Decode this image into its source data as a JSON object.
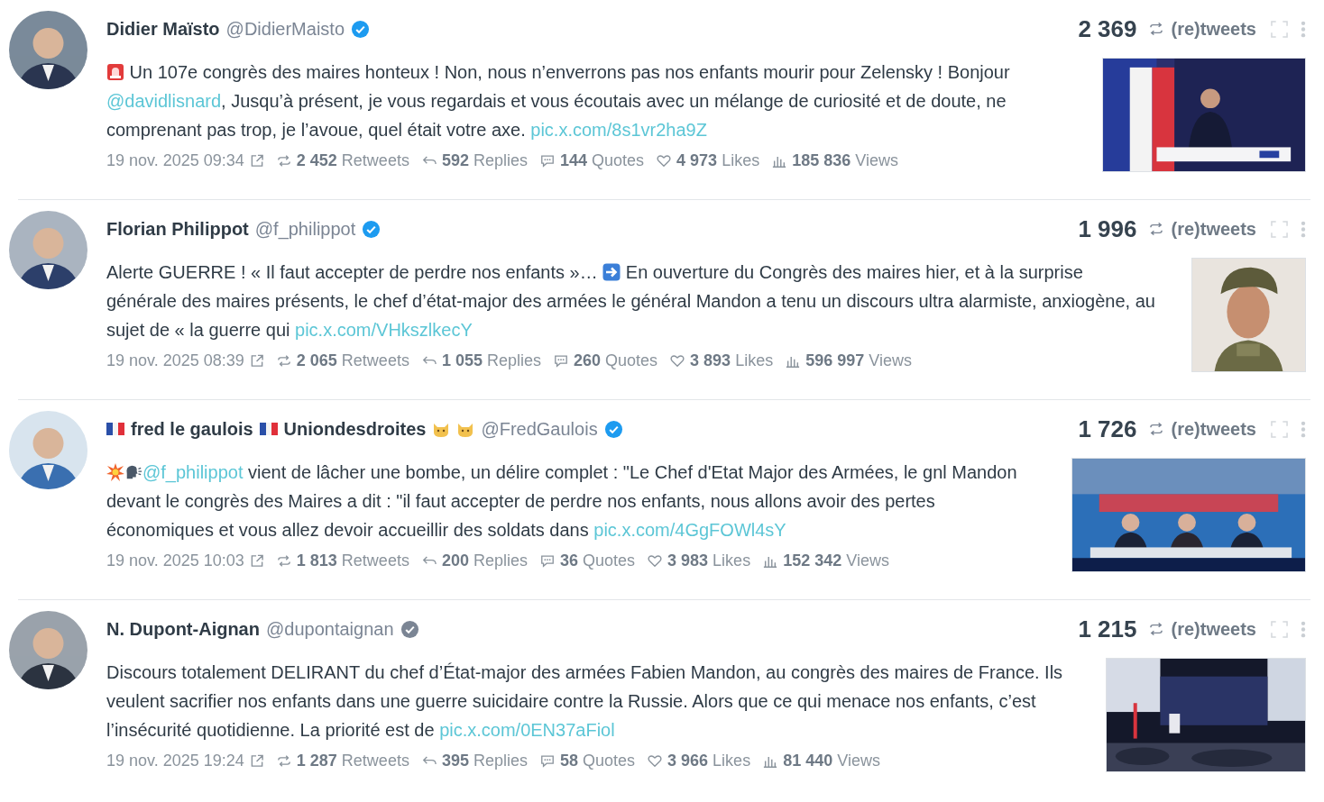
{
  "tweets": [
    {
      "avatar": {
        "kind": "picture"
      },
      "name": [
        {
          "kind": "text",
          "text": "Didier Maïsto"
        }
      ],
      "handle": "@DidierMaisto",
      "badge": {
        "color": "#1d9bf0"
      },
      "count": "2 369",
      "count_label": "(re)tweets",
      "body": [
        {
          "kind": "siren"
        },
        {
          "kind": "text",
          "text": " Un 107e congrès des maires honteux ! Non, nous n’enverrons pas nos enfants mourir pour Zelensky ! Bonjour "
        },
        {
          "kind": "link",
          "text": "@davidlisnard"
        },
        {
          "kind": "text",
          "text": ", Jusqu’à présent, je vous regardais et vous écoutais avec un mélange de curiosité et de doute, ne comprenant pas trop, je l’avoue, quel était votre axe. "
        },
        {
          "kind": "link",
          "text": "pic.x.com/8s1vr2ha9Z"
        }
      ],
      "date": "19 nov. 2025 09:34",
      "stats": [
        {
          "kind": "retweets",
          "text": "**2 452** Retweets"
        },
        {
          "kind": "replies",
          "text": "**592** Replies"
        },
        {
          "kind": "quotes",
          "text": "**144** Quotes"
        },
        {
          "kind": "likes",
          "text": "**4 973** Likes"
        },
        {
          "kind": "views",
          "text": "**185 836** Views"
        }
      ],
      "media": {
        "kind": "picture"
      }
    },
    {
      "avatar": {
        "kind": "picture"
      },
      "name": [
        {
          "kind": "text",
          "text": "Florian Philippot"
        }
      ],
      "handle": "@f_philippot",
      "badge": {
        "color": "#1d9bf0"
      },
      "count": "1 996",
      "count_label": "(re)tweets",
      "body": [
        {
          "kind": "text",
          "text": "Alerte GUERRE ! « Il faut accepter de perdre nos enfants »… "
        },
        {
          "kind": "arrow"
        },
        {
          "kind": "text",
          "text": " En ouverture du Congrès des maires hier, et à la surprise générale des maires présents, le chef d’état-major des armées le général Mandon a tenu un discours ultra alarmiste, anxiogène, au sujet de « la guerre qui "
        },
        {
          "kind": "link",
          "text": "pic.x.com/VHkszlkecY"
        }
      ],
      "date": "19 nov. 2025 08:39",
      "stats": [
        {
          "kind": "retweets",
          "text": "**2 065** Retweets"
        },
        {
          "kind": "replies",
          "text": "**1 055** Replies"
        },
        {
          "kind": "quotes",
          "text": "**260** Quotes"
        },
        {
          "kind": "likes",
          "text": "**3 893** Likes"
        },
        {
          "kind": "views",
          "text": "**596 997** Views"
        }
      ],
      "media": {
        "kind": "picture"
      }
    },
    {
      "avatar": {
        "kind": "picture"
      },
      "name": [
        {
          "kind": "flag"
        },
        {
          "kind": "text",
          "text": "fred le gaulois"
        },
        {
          "kind": "flag"
        },
        {
          "kind": "text",
          "text": "Uniondesdroites"
        },
        {
          "kind": "cat"
        },
        {
          "kind": "cat"
        }
      ],
      "handle": "@FredGaulois",
      "badge": {
        "color": "#1d9bf0"
      },
      "count": "1 726",
      "count_label": "(re)tweets",
      "body": [
        {
          "kind": "explosion"
        },
        {
          "kind": "speaking"
        },
        {
          "kind": "link",
          "text": "@f_philippot"
        },
        {
          "kind": "text",
          "text": " vient de lâcher une bombe, un délire complet : \"Le Chef d'Etat Major des Armées, le gnl Mandon devant le congrès des Maires a dit : \"il faut accepter de perdre nos enfants, nous allons avoir des pertes économiques et vous allez devoir accueillir des soldats dans "
        },
        {
          "kind": "link",
          "text": "pic.x.com/4GgFOWl4sY"
        }
      ],
      "date": "19 nov. 2025 10:03",
      "stats": [
        {
          "kind": "retweets",
          "text": "**1 813** Retweets"
        },
        {
          "kind": "replies",
          "text": "**200** Replies"
        },
        {
          "kind": "quotes",
          "text": "**36** Quotes"
        },
        {
          "kind": "likes",
          "text": "**3 983** Likes"
        },
        {
          "kind": "views",
          "text": "**152 342** Views"
        }
      ],
      "media": {
        "kind": "picture"
      }
    },
    {
      "avatar": {
        "kind": "picture"
      },
      "name": [
        {
          "kind": "text",
          "text": "N. Dupont-Aignan"
        }
      ],
      "handle": "@dupontaignan",
      "badge": {
        "color": "#7b8594"
      },
      "count": "1 215",
      "count_label": "(re)tweets",
      "body": [
        {
          "kind": "text",
          "text": "Discours totalement DELIRANT du chef d’État-major des armées Fabien Mandon, au congrès des maires de France. Ils veulent sacrifier nos enfants dans une guerre suicidaire contre la Russie. Alors que ce qui menace nos enfants, c’est l’insécurité quotidienne. La priorité est de "
        },
        {
          "kind": "link",
          "text": "pic.x.com/0EN37aFiol"
        }
      ],
      "date": "19 nov. 2025 19:24",
      "stats": [
        {
          "kind": "retweets",
          "text": "**1 287** Retweets"
        },
        {
          "kind": "replies",
          "text": "**395** Replies"
        },
        {
          "kind": "quotes",
          "text": "**58** Quotes"
        },
        {
          "kind": "likes",
          "text": "**3 966** Likes"
        },
        {
          "kind": "views",
          "text": "**81 440** Views"
        }
      ],
      "media": {
        "kind": "picture"
      }
    }
  ]
}
